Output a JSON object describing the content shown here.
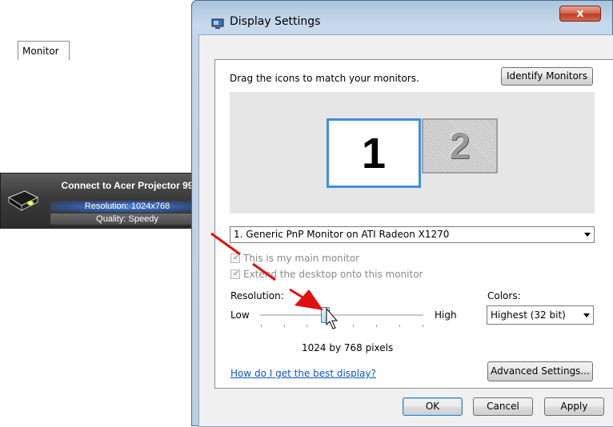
{
  "projector": {
    "title": "Connect to Acer Projector 99",
    "resolution": "Resolution: 1024x768",
    "quality": "Quality: Speedy",
    "icon": "projector-icon"
  },
  "window": {
    "title": "Display Settings",
    "icon": "display-settings-icon",
    "close_label": "x"
  },
  "tabs": [
    {
      "label": "Monitor"
    }
  ],
  "monitor_tab": {
    "instruction": "Drag the icons to match your monitors.",
    "identify_button": "Identify Monitors",
    "monitors": [
      {
        "number": "1"
      },
      {
        "number": "2"
      }
    ],
    "monitor_select": "1. Generic PnP Monitor on ATI Radeon X1270",
    "main_monitor_checkbox": {
      "label": "This is my main monitor",
      "checked": true
    },
    "extend_checkbox": {
      "label": "Extend the desktop onto this monitor",
      "checked": true
    },
    "resolution": {
      "label": "Resolution:",
      "low": "Low",
      "high": "High",
      "value": "1024 by 768 pixels",
      "slider_position": 0.4
    },
    "colors": {
      "label": "Colors:",
      "selected": "Highest (32 bit)"
    },
    "help_link": "How do I get the best display?",
    "advanced_button": "Advanced Settings..."
  },
  "footer": {
    "ok": "OK",
    "cancel": "Cancel",
    "apply": "Apply"
  },
  "colors": {
    "accent_arrow": "#e01010",
    "monitor_selected_border": "#3f8fe0",
    "link": "#0b55c4"
  }
}
